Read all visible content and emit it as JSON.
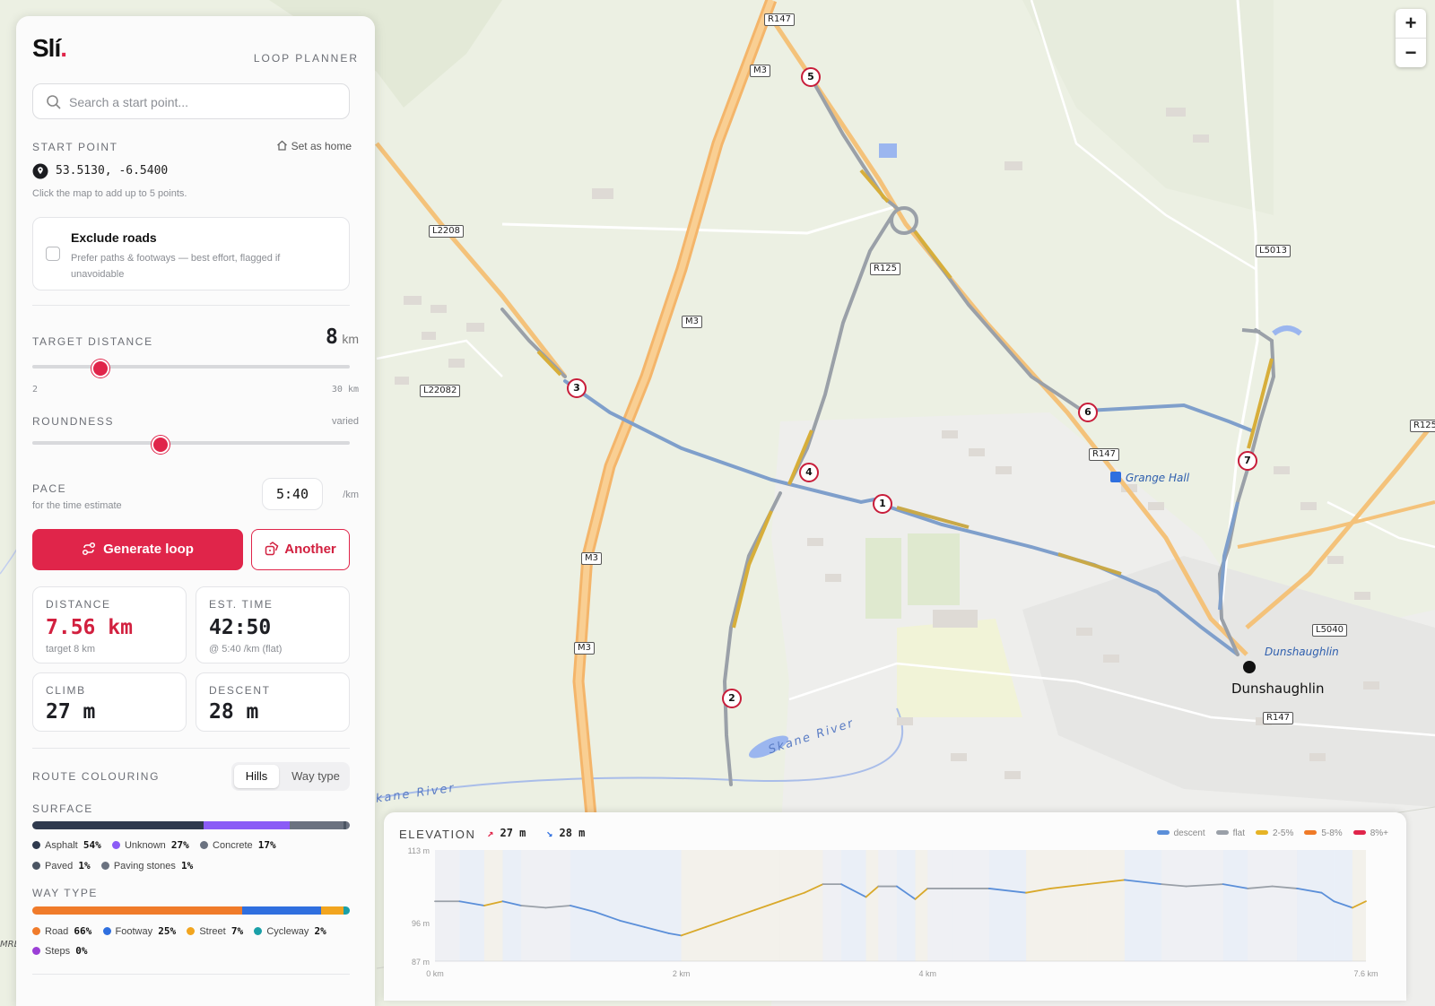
{
  "app": {
    "logo": "Slí",
    "logo_dot": ".",
    "subtitle": "LOOP PLANNER"
  },
  "search": {
    "placeholder": "Search a start point..."
  },
  "start": {
    "label": "START POINT",
    "set_home": "Set as home",
    "coords": "53.5130, -6.5400",
    "hint": "Click the map to add up to 5 points."
  },
  "exclude": {
    "title": "Exclude roads",
    "desc": "Prefer paths & footways — best effort, flagged if unavoidable",
    "checked": false
  },
  "target": {
    "label": "TARGET DISTANCE",
    "value": "8",
    "unit": "km",
    "min": "2",
    "max": "30 km",
    "level": 0.215
  },
  "roundness": {
    "label": "ROUNDNESS",
    "value": "varied",
    "level": 0.405
  },
  "pace": {
    "label": "PACE",
    "sub": "for the time estimate",
    "value": "5:40",
    "unit": "/km"
  },
  "buttons": {
    "generate": "Generate loop",
    "another": "Another"
  },
  "stats": {
    "distance": {
      "label": "DISTANCE",
      "value": "7.56 km",
      "sub": "target 8 km"
    },
    "time": {
      "label": "EST. TIME",
      "value": "42:50",
      "sub": "@ 5:40 /km (flat)"
    },
    "climb": {
      "label": "CLIMB",
      "value": "27 m"
    },
    "descent": {
      "label": "DESCENT",
      "value": "28 m"
    }
  },
  "colouring": {
    "label": "ROUTE COLOURING",
    "options": [
      "Hills",
      "Way type"
    ],
    "selected": "Hills"
  },
  "surface": {
    "label": "SURFACE",
    "items": [
      {
        "name": "Asphalt",
        "pct": "54%",
        "value": 54,
        "color": "#2f3a4e"
      },
      {
        "name": "Unknown",
        "pct": "27%",
        "value": 27,
        "color": "#8b5cf6"
      },
      {
        "name": "Concrete",
        "pct": "17%",
        "value": 17,
        "color": "#6b7280"
      },
      {
        "name": "Paved",
        "pct": "1%",
        "value": 1,
        "color": "#4b5563"
      },
      {
        "name": "Paving stones",
        "pct": "1%",
        "value": 1,
        "color": "#6b7280"
      }
    ]
  },
  "waytype": {
    "label": "WAY TYPE",
    "items": [
      {
        "name": "Road",
        "pct": "66%",
        "value": 66,
        "color": "#f07b2a"
      },
      {
        "name": "Footway",
        "pct": "25%",
        "value": 25,
        "color": "#2f6fdf"
      },
      {
        "name": "Street",
        "pct": "7%",
        "value": 7,
        "color": "#f2a51f"
      },
      {
        "name": "Cycleway",
        "pct": "2%",
        "value": 2,
        "color": "#1aa0a8"
      },
      {
        "name": "Steps",
        "pct": "0%",
        "value": 0,
        "color": "#9b3fd6"
      }
    ]
  },
  "map": {
    "waypoints": [
      "1",
      "2",
      "3",
      "4",
      "5",
      "6",
      "7"
    ],
    "roads": [
      "R147",
      "M3",
      "M3",
      "M3",
      "M3",
      "L2208",
      "L22082",
      "R125",
      "R147",
      "L5013",
      "L5040",
      "R147",
      "R125"
    ],
    "places": {
      "town": "Dunshaughlin",
      "hall": "Grange Hall",
      "river1": "Skane River",
      "river2": "kane River",
      "station": "Dunshaughlin",
      "edge": "MRE"
    },
    "zoom_in": "+",
    "zoom_out": "−"
  },
  "elevation": {
    "label": "ELEVATION",
    "climb": "27 m",
    "descent": "28 m",
    "legend": [
      {
        "name": "descent",
        "color": "#5b8fd9"
      },
      {
        "name": "flat",
        "color": "#9aa0a8"
      },
      {
        "name": "2-5%",
        "color": "#e6b325"
      },
      {
        "name": "5-8%",
        "color": "#ef7a27"
      },
      {
        "name": "8%+",
        "color": "#e0254a"
      }
    ],
    "y_ticks": [
      "113 m",
      "96 m",
      "87 m"
    ],
    "x_ticks": [
      "0 km",
      "2 km",
      "4 km",
      "7.6 km"
    ]
  },
  "chart_data": {
    "type": "area",
    "xlabel": "",
    "ylabel": "",
    "xlim": [
      0,
      7.56
    ],
    "ylim": [
      87,
      113
    ],
    "x": [
      0,
      0.2,
      0.4,
      0.55,
      0.7,
      0.9,
      1.1,
      1.3,
      1.5,
      1.7,
      1.9,
      2.0,
      2.2,
      2.4,
      2.6,
      2.8,
      3.0,
      3.15,
      3.3,
      3.5,
      3.6,
      3.75,
      3.9,
      4.0,
      4.2,
      4.5,
      4.8,
      5.0,
      5.3,
      5.6,
      5.9,
      6.1,
      6.4,
      6.6,
      6.8,
      7.0,
      7.2,
      7.3,
      7.45,
      7.56
    ],
    "y": [
      101,
      101,
      100,
      101,
      100,
      99.5,
      100,
      98.5,
      96.5,
      95,
      93.5,
      93,
      95,
      97,
      99,
      101,
      103,
      105,
      105,
      102,
      104.5,
      104.5,
      101.5,
      104,
      104,
      104,
      103,
      104,
      105,
      106,
      105,
      104.5,
      105,
      104,
      104.5,
      104,
      103,
      101,
      99.5,
      101
    ]
  }
}
